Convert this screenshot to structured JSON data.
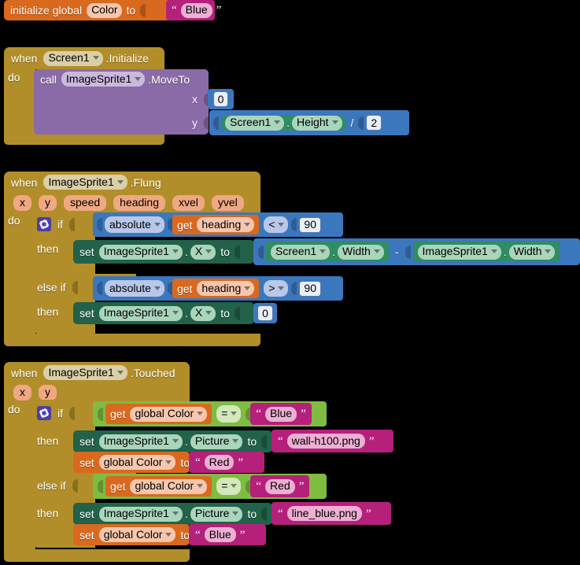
{
  "workspace": {
    "background": "#000000",
    "palette": {
      "event": "#b18e2a",
      "control": "#b18e2a",
      "method": "#8b6aa8",
      "math": "#3b77bd",
      "setter": "#22614a",
      "getter": "#2f8c63",
      "variable": "#d9691e",
      "logic": "#7fbc42",
      "text": "#b5207b"
    }
  },
  "blocks": {
    "init_global": {
      "keyword": "initialize global",
      "name": "Color",
      "to": "to",
      "value": "Blue"
    },
    "screen_initialize": {
      "when": "when",
      "component": "Screen1",
      "event": ".Initialize",
      "do": "do",
      "call": {
        "call": "call",
        "component": "ImageSprite1",
        "method": ".MoveTo",
        "arg_x_label": "x",
        "arg_x_value": "0",
        "arg_y_label": "y",
        "arg_y_expr": {
          "left_component": "Screen1",
          "left_dot": ".",
          "left_property": "Height",
          "operator": "/",
          "right_value": "2"
        }
      }
    },
    "sprite_flung": {
      "when": "when",
      "component": "ImageSprite1",
      "event": ".Flung",
      "params": [
        "x",
        "y",
        "speed",
        "heading",
        "xvel",
        "yvel"
      ],
      "do": "do",
      "if_label": "if",
      "then_label": "then",
      "elseif_label": "else if",
      "cond1": {
        "func": "absolute",
        "get": "get",
        "variable": "heading",
        "operator": "<",
        "value": "90"
      },
      "then1": {
        "set": "set",
        "component": "ImageSprite1",
        "dot": ".",
        "property": "X",
        "to": "to",
        "expr": {
          "left_component": "Screen1",
          "left_dot": ".",
          "left_property": "Width",
          "operator": "-",
          "right_component": "ImageSprite1",
          "right_dot": ".",
          "right_property": "Width"
        }
      },
      "cond2": {
        "func": "absolute",
        "get": "get",
        "variable": "heading",
        "operator": ">",
        "value": "90"
      },
      "then2": {
        "set": "set",
        "component": "ImageSprite1",
        "dot": ".",
        "property": "X",
        "to": "to",
        "value": "0"
      }
    },
    "sprite_touched": {
      "when": "when",
      "component": "ImageSprite1",
      "event": ".Touched",
      "params": [
        "x",
        "y"
      ],
      "do": "do",
      "if_label": "if",
      "then_label": "then",
      "elseif_label": "else if",
      "cond1": {
        "get": "get",
        "variable": "global Color",
        "operator": "=",
        "value": "Blue"
      },
      "then1_a": {
        "set": "set",
        "component": "ImageSprite1",
        "dot": ".",
        "property": "Picture",
        "to": "to",
        "value": "wall-h100.png"
      },
      "then1_b": {
        "set": "set",
        "variable": "global Color",
        "to": "to",
        "value": "Red"
      },
      "cond2": {
        "get": "get",
        "variable": "global Color",
        "operator": "=",
        "value": "Red"
      },
      "then2_a": {
        "set": "set",
        "component": "ImageSprite1",
        "dot": ".",
        "property": "Picture",
        "to": "to",
        "value": "line_blue.png"
      },
      "then2_b": {
        "set": "set",
        "variable": "global Color",
        "to": "to",
        "value": "Blue"
      }
    }
  }
}
